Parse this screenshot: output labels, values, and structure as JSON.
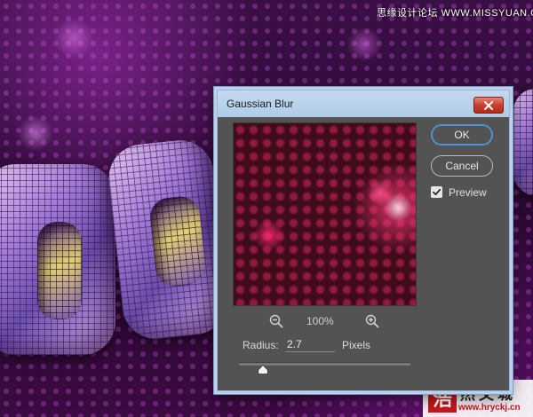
{
  "watermark": {
    "top_text": "思缘设计论坛 WWW.MISSYUAN.COM",
    "seal_char": "浩",
    "name": "然文城",
    "url": "www.hryckj.cn"
  },
  "dialog": {
    "title": "Gaussian Blur",
    "ok_label": "OK",
    "cancel_label": "Cancel",
    "preview_label": "Preview",
    "preview_checked": true,
    "zoom_level": "100%",
    "radius_label": "Radius:",
    "radius_value": "2.7",
    "units_label": "Pixels",
    "radius_slider_fraction": 0.14
  },
  "icons": {
    "close": "close-icon",
    "zoom_out": "zoom-out-icon",
    "zoom_in": "zoom-in-icon",
    "check": "checkmark-icon",
    "thumb": "slider-thumb-icon"
  },
  "colors": {
    "dialog_bg": "#535353",
    "titlebar": "#b0cbe8",
    "close_button": "#c8402f",
    "ok_border": "#4e8fd6",
    "preview_dots": "#d2285a"
  }
}
